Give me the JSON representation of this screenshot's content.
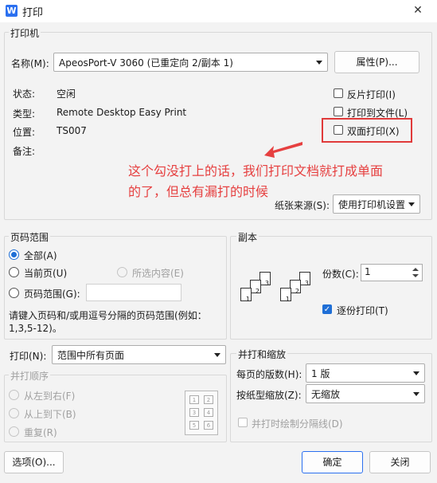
{
  "window": {
    "title": "打印",
    "app_icon_glyph": "W"
  },
  "printer": {
    "group_label": "打印机",
    "name_label": "名称(M):",
    "name_value": "ApeosPort-V 3060 (已重定向 2/副本 1)",
    "properties_button": "属性(P)...",
    "status_label": "状态:",
    "status_value": "空闲",
    "type_label": "类型:",
    "type_value": "Remote Desktop Easy Print",
    "location_label": "位置:",
    "location_value": "TS007",
    "comment_label": "备注:",
    "reverse_print": "反片打印(I)",
    "print_to_file": "打印到文件(L)",
    "duplex_print": "双面打印(X)",
    "paper_source_label": "纸张来源(S):",
    "paper_source_value": "使用打印机设置"
  },
  "annotation": {
    "line1": "这个勾没打上的话，我们打印文档就打成单面",
    "line2": "的了，但总有漏打的时候"
  },
  "page_range": {
    "group_label": "页码范围",
    "all": "全部(A)",
    "current": "当前页(U)",
    "selection": "所选内容(E)",
    "range": "页码范围(G):",
    "hint_line1": "请键入页码和/或用逗号分隔的页码范围(例如：",
    "hint_line2": "1,3,5-12)。"
  },
  "copies": {
    "group_label": "副本",
    "count_label": "份数(C):",
    "count_value": "1",
    "collate": "逐份打印(T)",
    "page_numbers": [
      "1",
      "2",
      "3"
    ]
  },
  "print_what": {
    "label": "打印(N):",
    "value": "范围中所有页面"
  },
  "print_order": {
    "group_label": "并打顺序",
    "left_to_right": "从左到右(F)",
    "top_to_bottom": "从上到下(B)",
    "repeat": "重复(R)",
    "grid_numbers": [
      "1",
      "2",
      "3",
      "4",
      "5",
      "6"
    ]
  },
  "zoom": {
    "group_label": "并打和缩放",
    "pages_per_sheet_label": "每页的版数(H):",
    "pages_per_sheet_value": "1 版",
    "scale_label": "按纸型缩放(Z):",
    "scale_value": "无缩放",
    "draw_borders": "并打时绘制分隔线(D)"
  },
  "footer": {
    "options_button": "选项(O)...",
    "ok_button": "确定",
    "cancel_button": "关闭"
  }
}
